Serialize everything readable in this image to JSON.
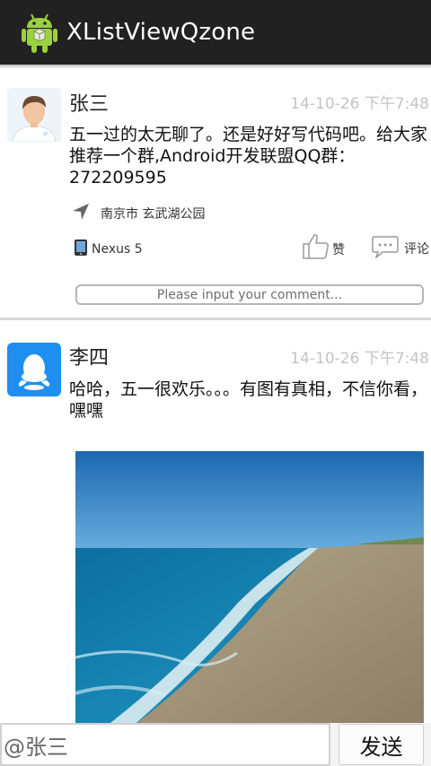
{
  "app": {
    "title": "XListViewQzone",
    "icon": "android-robot-icon"
  },
  "posts": [
    {
      "user": "张三",
      "avatar": "default-person-avatar",
      "time": "14-10-26 下午7:48",
      "text": "五一过的太无聊了。还是好好写代码吧。给大家推荐一个群,Android开发联盟QQ群：272209595",
      "location": "南京市 玄武湖公园",
      "device": "Nexus 5",
      "like_label": "赞",
      "comment_label": "评论",
      "comment_placeholder": "Please input your comment..."
    },
    {
      "user": "李四",
      "avatar": "qq-penguin-avatar",
      "time": "14-10-26 下午7:48",
      "text": "哈哈，五一很欢乐。。。有图有真相，不信你看，嘿嘿",
      "photo": "beach-photo"
    }
  ],
  "reply": {
    "value": "@张三",
    "send_label": "发送"
  },
  "colors": {
    "actionbar": "#212121",
    "timestamp": "#c4c4c4",
    "qq_blue": "#1e8ff0"
  }
}
